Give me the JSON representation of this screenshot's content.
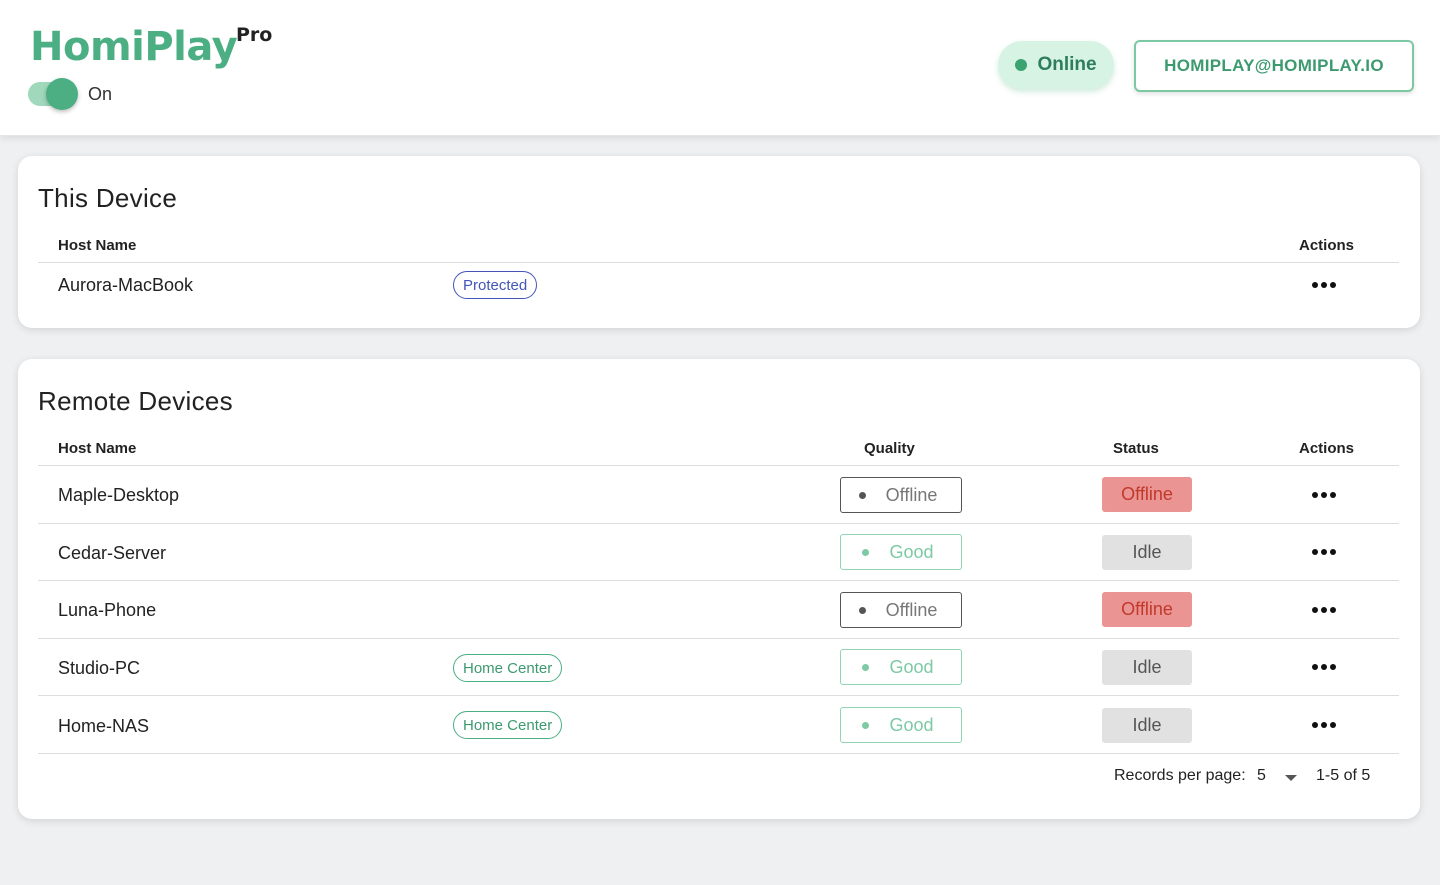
{
  "header": {
    "brand_name": "HomiPlay",
    "brand_tier": "Pro",
    "toggle_label": "On",
    "toggle_state": "on",
    "status_label": "Online",
    "account_email": "HOMIPLAY@HOMIPLAY.IO",
    "accent_color": "#4caf84"
  },
  "this_device": {
    "title": "This Device",
    "columns": {
      "host": "Host Name",
      "actions": "Actions"
    },
    "rows": [
      {
        "host": "Aurora-MacBook",
        "tag": "Protected",
        "actions_icon": "more-horizontal-icon"
      }
    ]
  },
  "remote_devices": {
    "title": "Remote Devices",
    "columns": {
      "host": "Host Name",
      "quality": "Quality",
      "status": "Status",
      "actions": "Actions"
    },
    "rows": [
      {
        "host": "Maple-Desktop",
        "tag": "",
        "quality": "Offline",
        "status": "Offline"
      },
      {
        "host": "Cedar-Server",
        "tag": "",
        "quality": "Good",
        "status": "Idle"
      },
      {
        "host": "Luna-Phone",
        "tag": "",
        "quality": "Offline",
        "status": "Offline"
      },
      {
        "host": "Studio-PC",
        "tag": "Home Center",
        "quality": "Good",
        "status": "Idle"
      },
      {
        "host": "Home-NAS",
        "tag": "Home Center",
        "quality": "Good",
        "status": "Idle"
      }
    ],
    "pagination": {
      "label": "Records per page:",
      "per_page": "5",
      "range": "1-5 of 5"
    }
  },
  "colors": {
    "offline_status_bg": "#eb9494",
    "idle_status_bg": "#e1e1e1",
    "good_quality": "#7dcaa4",
    "protected_tag": "#4355b9"
  }
}
